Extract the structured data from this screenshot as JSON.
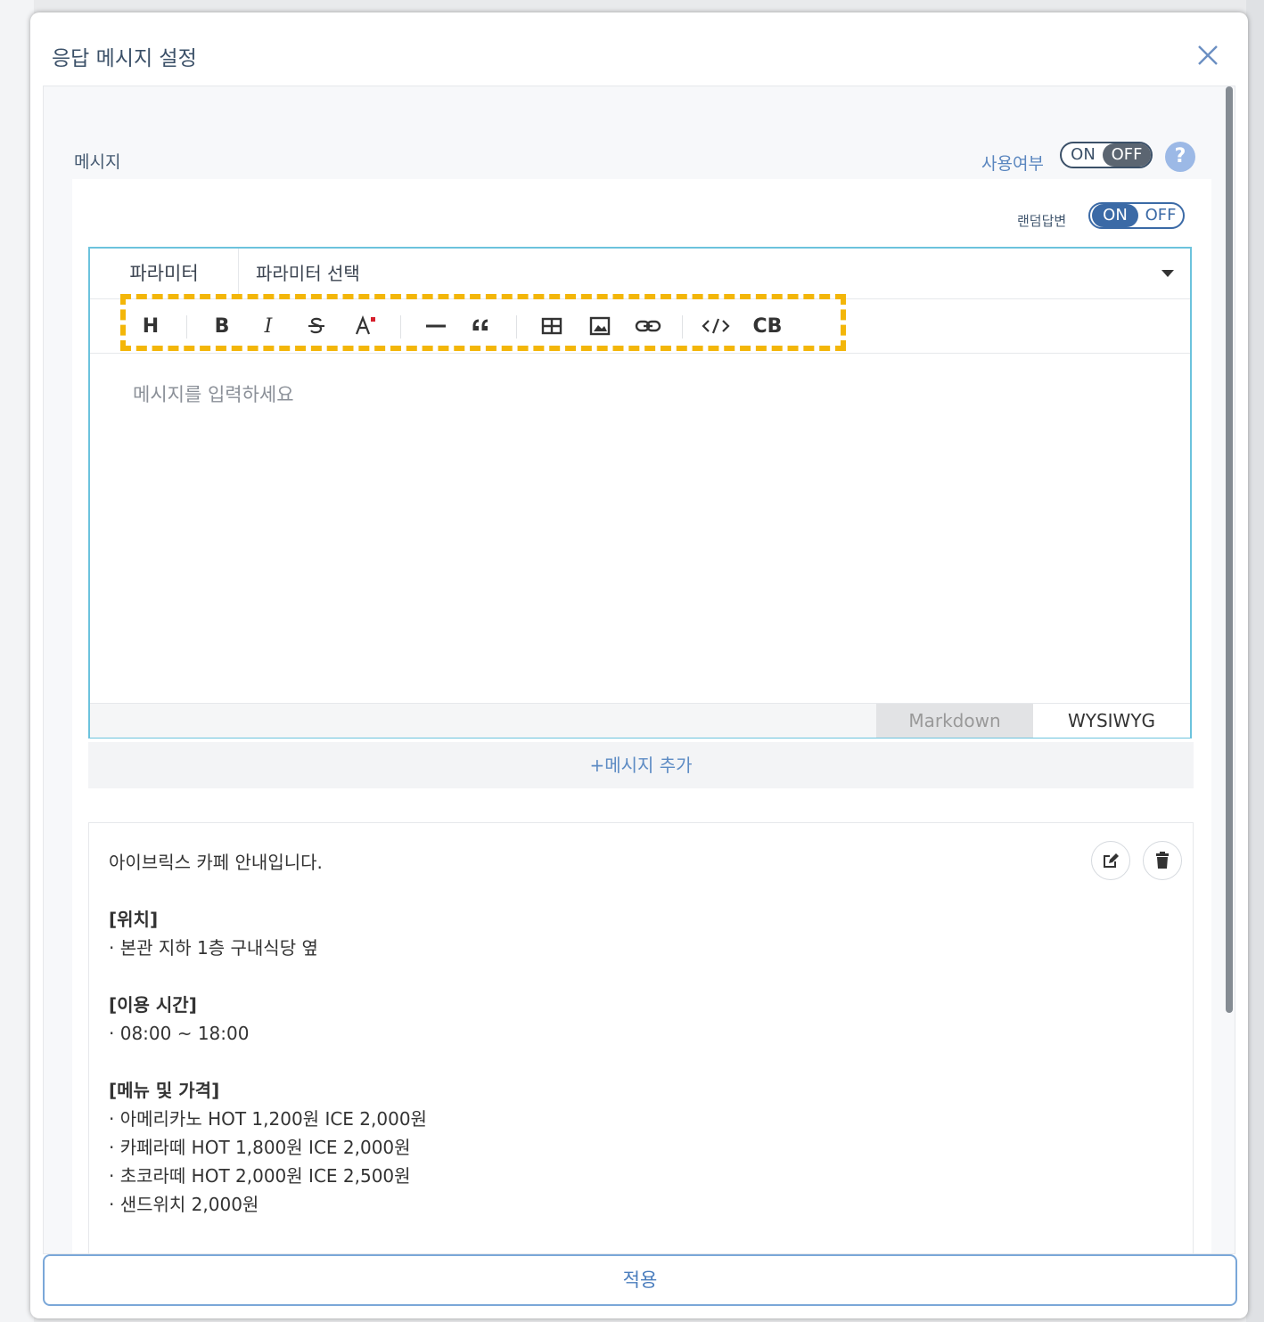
{
  "modal": {
    "title": "응답 메시지 설정",
    "close_icon": "close-icon",
    "apply_label": "적용"
  },
  "section": {
    "label": "메시지",
    "use_label": "사용여부",
    "use_toggle": {
      "on": "ON",
      "off": "OFF",
      "state": "OFF"
    },
    "help_icon": "?"
  },
  "random": {
    "label": "랜덤답변",
    "toggle": {
      "on": "ON",
      "off": "OFF",
      "state": "ON"
    }
  },
  "editor": {
    "param_label": "파라미터",
    "param_select": "파라미터 선택",
    "toolbar": {
      "heading": "H",
      "bold": "B",
      "italic": "I",
      "code_block": "CB",
      "icons": [
        "heading-icon",
        "bold-icon",
        "italic-icon",
        "strike-icon",
        "text-color-icon",
        "hr-icon",
        "quote-icon",
        "table-icon",
        "image-icon",
        "link-icon",
        "code-icon",
        "code-block-icon"
      ]
    },
    "placeholder": "메시지를 입력하세요",
    "modes": {
      "markdown": "Markdown",
      "wysiwyg": "WYSIWYG",
      "active": "WYSIWYG"
    }
  },
  "add_message": "+메시지 추가",
  "message": {
    "line1": "아이브릭스 카페 안내입니다.",
    "loc_title": "[위치]",
    "loc_1": "· 본관 지하 1층 구내식당 옆",
    "time_title": "[이용 시간]",
    "time_1": "· 08:00 ~ 18:00",
    "menu_title": "[메뉴 및 가격]",
    "menu": [
      "· 아메리카노 HOT 1,200원 ICE 2,000원",
      "· 카페라떼 HOT 1,800원 ICE 2,000원",
      "· 초코라떼 HOT 2,000원 ICE 2,500원",
      "· 샌드위치 2,000원"
    ]
  },
  "colors": {
    "highlight": "#f3b609",
    "accent": "#3b6aa6",
    "editor_border": "#6cc3dd"
  }
}
